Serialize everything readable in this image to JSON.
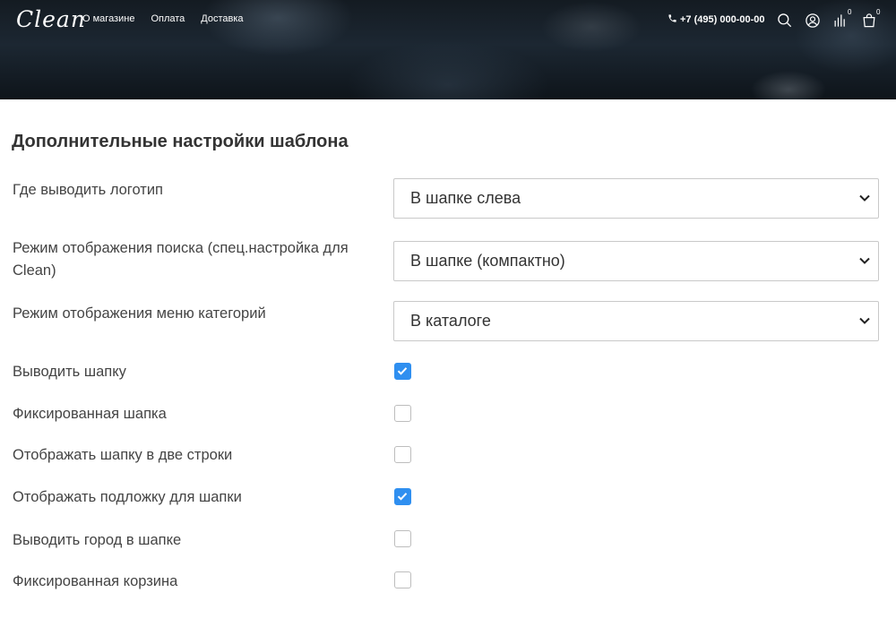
{
  "header": {
    "logo": "Clean",
    "nav": [
      "О магазине",
      "Оплата",
      "Доставка"
    ],
    "phone": "+7 (495) 000-00-00",
    "compare_count": "0",
    "cart_count": "0",
    "icons": [
      "phone-icon",
      "search-icon",
      "user-icon",
      "compare-icon",
      "cart-icon"
    ]
  },
  "settings": {
    "title": "Дополнительные настройки шаблона",
    "selects": [
      {
        "label": "Где выводить логотип",
        "value": "В шапке слева"
      },
      {
        "label": "Режим отображения поиска (спец.настройка для Clean)",
        "value": "В шапке (компактно)"
      },
      {
        "label": "Режим отображения меню категорий",
        "value": "В каталоге"
      }
    ],
    "checkboxes": [
      {
        "label": "Выводить шапку",
        "checked": true
      },
      {
        "label": "Фиксированная шапка",
        "checked": false
      },
      {
        "label": "Отображать шапку в две строки",
        "checked": false
      },
      {
        "label": "Отображать подложку для шапки",
        "checked": true
      },
      {
        "label": "Выводить город в шапке",
        "checked": false
      },
      {
        "label": "Фиксированная корзина",
        "checked": false
      }
    ]
  },
  "colors": {
    "accent": "#2f8ff0",
    "header_bg": "#141b22"
  }
}
